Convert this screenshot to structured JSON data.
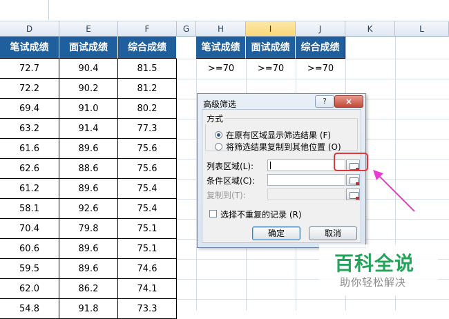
{
  "columns": [
    "D",
    "E",
    "F",
    "G",
    "H",
    "I",
    "J",
    "K",
    "L"
  ],
  "table": {
    "headers": [
      "笔试成绩",
      "面试成绩",
      "综合成绩"
    ],
    "rows": [
      [
        "72.7",
        "90.4",
        "81.5"
      ],
      [
        "72.2",
        "90.2",
        "81.2"
      ],
      [
        "69.4",
        "91.0",
        "80.2"
      ],
      [
        "63.2",
        "91.4",
        "77.3"
      ],
      [
        "61.6",
        "89.6",
        "75.6"
      ],
      [
        "62.6",
        "88.6",
        "75.6"
      ],
      [
        "61.2",
        "89.6",
        "75.4"
      ],
      [
        "58.1",
        "92.6",
        "75.4"
      ],
      [
        "70.4",
        "79.8",
        "75.1"
      ],
      [
        "60.6",
        "89.6",
        "75.1"
      ],
      [
        "59.5",
        "89.6",
        "74.6"
      ],
      [
        "62.0",
        "86.2",
        "74.1"
      ],
      [
        "54.8",
        "91.8",
        "73.3"
      ]
    ]
  },
  "criteria": {
    "headers": [
      "笔试成绩",
      "面试成绩",
      "综合成绩"
    ],
    "values": [
      ">=70",
      ">=70",
      ">=70"
    ]
  },
  "dialog": {
    "title": "高级筛选",
    "help_label": "?",
    "close_label": "×",
    "group_label": "方式",
    "option1": "在原有区域显示筛选结果 (F)",
    "option2": "将筛选结果复制到其他位置 (O)",
    "list_range_label": "列表区域(L):",
    "criteria_range_label": "条件区域(C):",
    "copy_to_label": "复制到(T):",
    "unique_label": "选择不重复的记录 (R)",
    "ok_label": "确定",
    "cancel_label": "取消"
  },
  "watermark": {
    "title": "百科全说",
    "subtitle": "助你轻松解决"
  },
  "colors": {
    "header_blue": "#1f5f9d",
    "highlight_red": "#e0353a",
    "arrow_magenta": "#e83bd0",
    "watermark_green": "#23a45a"
  }
}
